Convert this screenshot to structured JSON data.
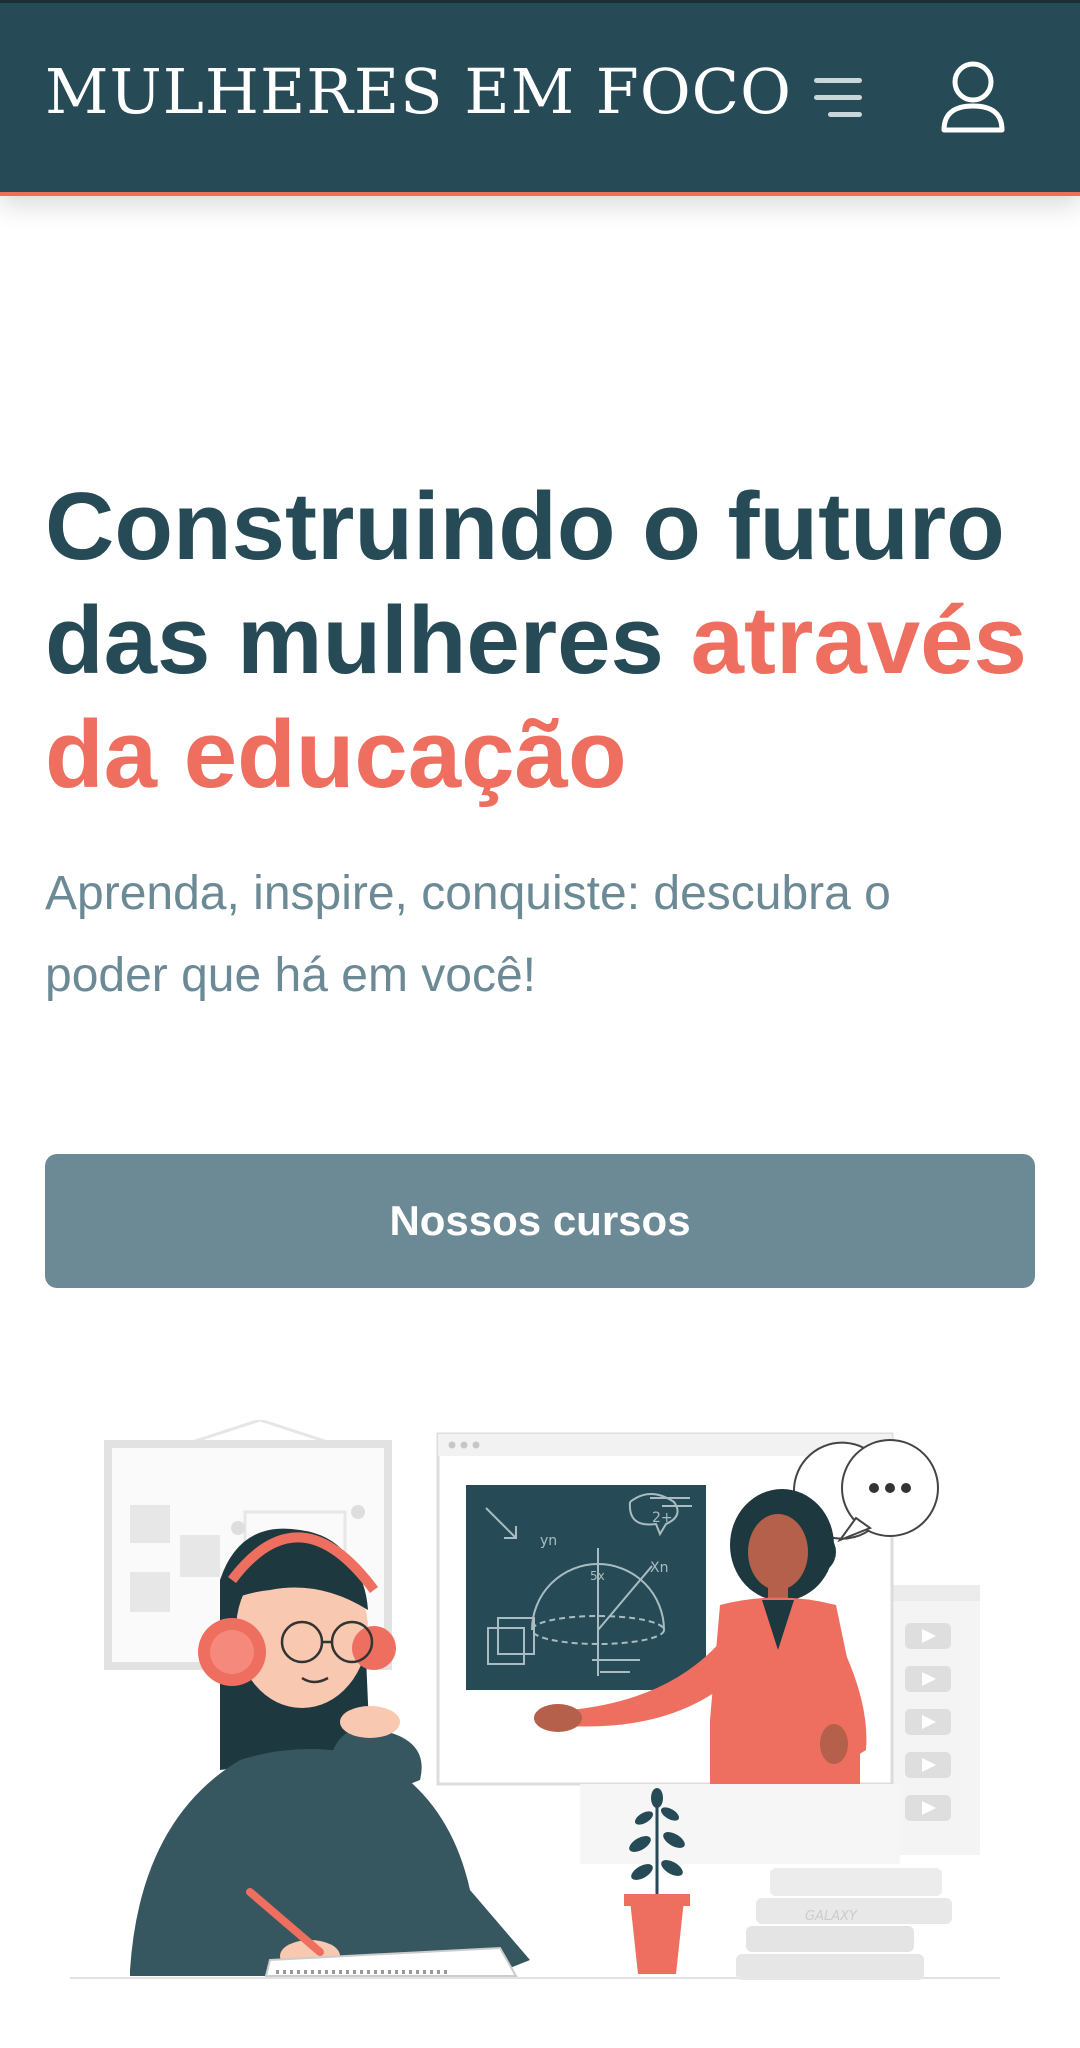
{
  "header": {
    "brand": "MULHERES EM FOCO",
    "menu_icon": "hamburger-menu-icon",
    "user_icon": "user-profile-icon",
    "background_color": "#274b56",
    "accent_border_color": "#ee6f5f"
  },
  "hero": {
    "title_part1": "Construindo o futuro das mulheres ",
    "title_accent": "através da educação",
    "subtitle": "Aprenda, inspire, conquiste: descubra o poder que há em você!",
    "cta_label": "Nossos cursos",
    "title_color": "#274b56",
    "accent_color": "#ee6f5f",
    "subtitle_color": "#6c8a95",
    "button_color": "#6c8a95"
  },
  "illustration": {
    "board_formula_1": "2+",
    "board_label_yn": "yn",
    "board_label_xn": "Xn",
    "board_label_5x": "5x",
    "book_label": "GALAXY"
  }
}
